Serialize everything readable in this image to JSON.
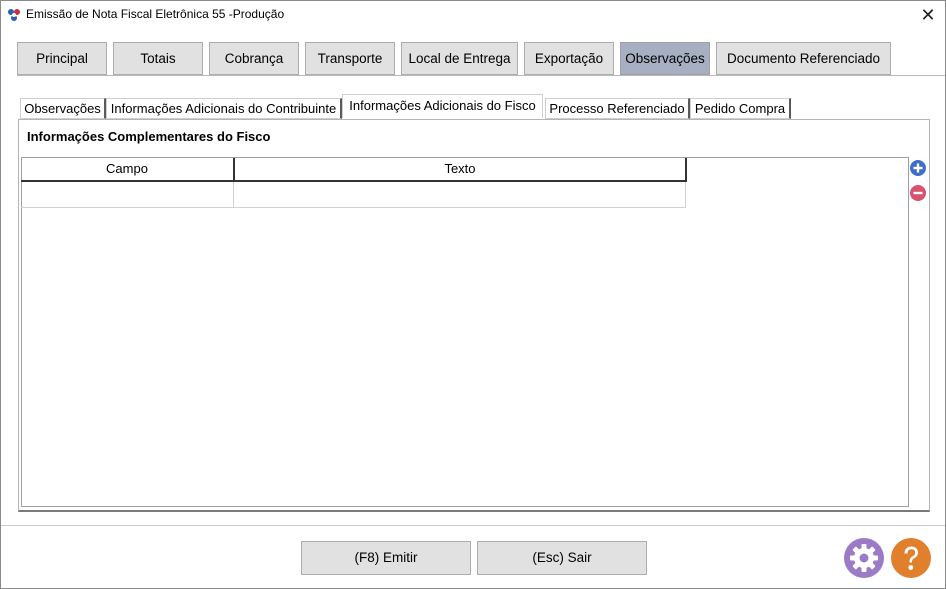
{
  "window": {
    "title": "Emissão de Nota Fiscal Eletrônica 55 -Produção",
    "close_glyph": "✕"
  },
  "main_tabs": [
    {
      "label": "Principal"
    },
    {
      "label": "Totais"
    },
    {
      "label": "Cobrança"
    },
    {
      "label": "Transporte"
    },
    {
      "label": "Local de Entrega"
    },
    {
      "label": "Exportação"
    },
    {
      "label": "Observações",
      "active": true
    },
    {
      "label": "Documento Referenciado"
    }
  ],
  "sub_tabs": [
    {
      "label": "Observações"
    },
    {
      "label": "Informações Adicionais do Contribuinte"
    },
    {
      "label": "Informações Adicionais do Fisco",
      "active": true
    },
    {
      "label": "Processo Referenciado"
    },
    {
      "label": "Pedido Compra"
    }
  ],
  "panel": {
    "title": "Informações Complementares do Fisco",
    "columns": [
      "Campo",
      "Texto"
    ],
    "rows": [
      {
        "campo": "",
        "texto": ""
      }
    ]
  },
  "footer": {
    "emitir_label": "(F8) Emitir",
    "sair_label": "(Esc) Sair"
  },
  "icons": {
    "add": "plus-circle-icon",
    "remove": "minus-circle-icon",
    "settings": "gear-icon",
    "help": "question-mark-icon"
  },
  "colors": {
    "active_tab": "#a7afc3",
    "add_icon": "#3f6fc6",
    "remove_icon": "#d6536d",
    "settings_icon": "#9b7bc7",
    "help_icon": "#e07f2c"
  }
}
